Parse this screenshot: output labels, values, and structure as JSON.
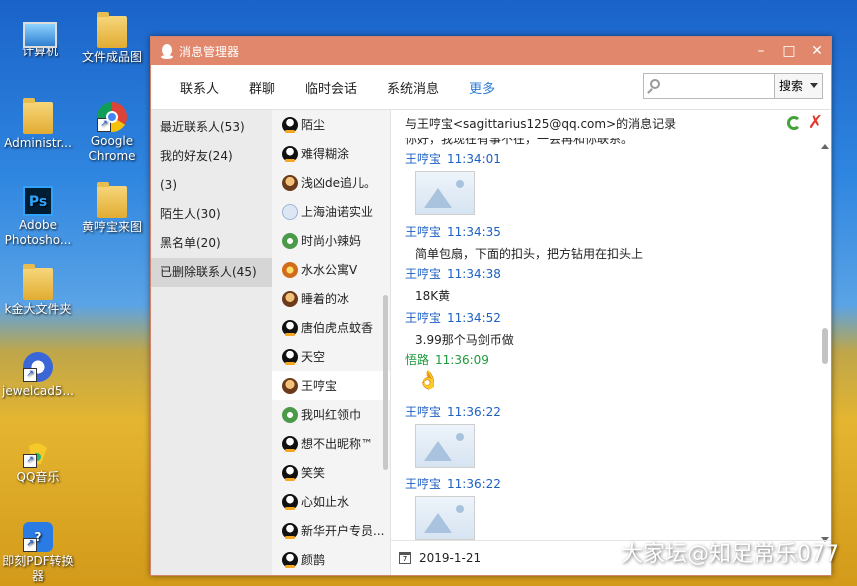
{
  "desktop": {
    "icons": [
      {
        "label": "计算机"
      },
      {
        "label": "文件成品图"
      },
      {
        "label": "Administr..."
      },
      {
        "label": "Google Chrome"
      },
      {
        "label": "Adobe Photosho..."
      },
      {
        "label": "黄哼宝来图"
      },
      {
        "label": "k金大文件夹"
      },
      {
        "label": "jewelcad5..."
      },
      {
        "label": "QQ音乐"
      },
      {
        "label": "即刻PDF转换器"
      }
    ],
    "ps_glyph": "Ps",
    "pdf_glyph": "?",
    "watermark": "大家坛@知足常乐077"
  },
  "window": {
    "title": "消息管理器",
    "controls": {
      "close": "✕",
      "minimize": "–",
      "maximize": "□"
    },
    "tabs": [
      "联系人",
      "群聊",
      "临时会话",
      "系统消息",
      "更多"
    ],
    "search": {
      "placeholder": "",
      "button": "搜索"
    }
  },
  "groups": [
    {
      "label": "最近联系人(53)"
    },
    {
      "label": "我的好友(24)"
    },
    {
      "label": "(3)"
    },
    {
      "label": "陌生人(30)"
    },
    {
      "label": "黑名单(20)"
    },
    {
      "label": "已删除联系人(45)"
    }
  ],
  "contacts": [
    {
      "name": "陌尘",
      "avatar": "penguin"
    },
    {
      "name": "难得糊涂",
      "avatar": "penguin"
    },
    {
      "name": "浅凶de追儿。",
      "avatar": "photo"
    },
    {
      "name": "上海油诺实业",
      "avatar": "cloud"
    },
    {
      "name": "时尚小辣妈",
      "avatar": "green"
    },
    {
      "name": "水水公寓V",
      "avatar": "orange"
    },
    {
      "name": "睡着的冰",
      "avatar": "photo"
    },
    {
      "name": "唐伯虎点蚊香",
      "avatar": "penguin"
    },
    {
      "name": "天空",
      "avatar": "penguin"
    },
    {
      "name": "王哼宝",
      "avatar": "photo"
    },
    {
      "name": "我叫红领巾",
      "avatar": "green"
    },
    {
      "name": "想不出昵称™",
      "avatar": "penguin"
    },
    {
      "name": "笑笑",
      "avatar": "penguin"
    },
    {
      "name": "心如止水",
      "avatar": "penguin"
    },
    {
      "name": "新华开户专员...",
      "avatar": "penguin"
    },
    {
      "name": "颜鹊",
      "avatar": "penguin"
    }
  ],
  "log": {
    "header": "与王哼宝<sagittarius125@qq.com>的消息记录",
    "cut_line": "你好，我现在有事不在，一会再和你联系。",
    "messages": [
      {
        "sender": "王哼宝",
        "time": "11:34:01",
        "type": "image",
        "text": ""
      },
      {
        "sender": "王哼宝",
        "time": "11:34:35",
        "type": "text",
        "text": "简单包扇，下面的扣头，把方钻用在扣头上"
      },
      {
        "sender": "王哼宝",
        "time": "11:34:38",
        "type": "text",
        "text": "18K黄"
      },
      {
        "sender": "王哼宝",
        "time": "11:34:52",
        "type": "text",
        "text": "3.99那个马剑币做"
      },
      {
        "sender": "悟路",
        "time": "11:36:09",
        "type": "emoji",
        "text": "👌"
      },
      {
        "sender": "王哼宝",
        "time": "11:36:22",
        "type": "image",
        "text": ""
      },
      {
        "sender": "王哼宝",
        "time": "11:36:22",
        "type": "image",
        "text": ""
      }
    ]
  },
  "date": "2019-1-21",
  "calendar_glyph": "7"
}
